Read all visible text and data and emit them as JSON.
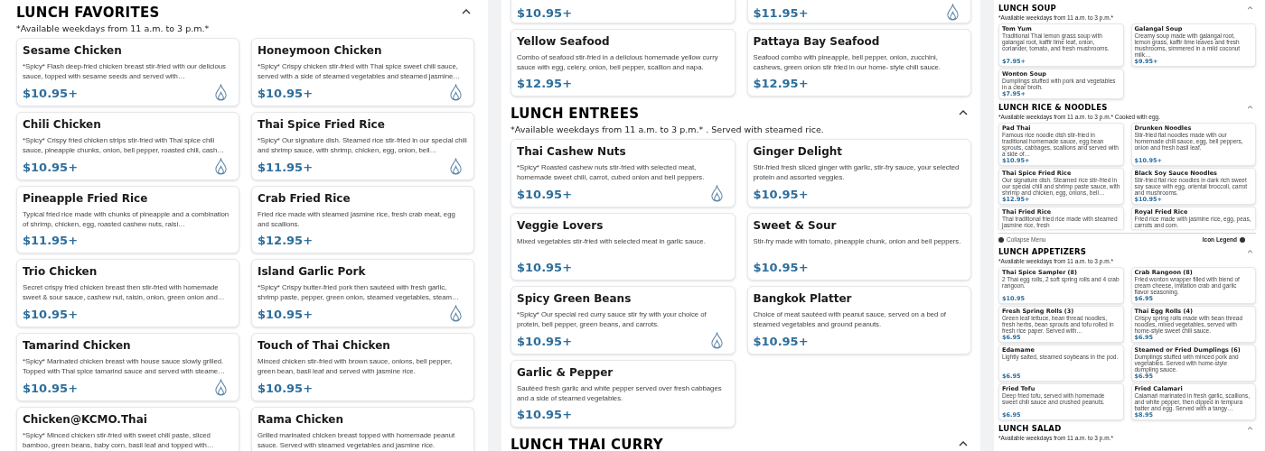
{
  "columns": [
    {
      "panels": [
        {
          "sections": [
            {
              "title": "LUNCH FAVORITES",
              "expanded": true,
              "note": "*Available weekdays from 11 a.m. to 3 p.m.*",
              "items": [
                {
                  "name": "Sesame Chicken",
                  "description": "*Spicy* Flash deep-fried chicken breast stir-fried with our delicious sauce, topped with sesame seeds and served with…",
                  "price": "$10.95+",
                  "spicy": true
                },
                {
                  "name": "Honeymoon Chicken",
                  "description": "*Spicy* Crispy chicken stir-fried with Thai spice sweet chili sauce, served with a side of steamed vegetables and steamed jasmine…",
                  "price": "$10.95+",
                  "spicy": true
                },
                {
                  "name": "Chili Chicken",
                  "description": "*Spicy* Crispy fried chicken strips stir-fried with Thai spice chili sauce, pineapple chunks, onion, bell pepper, roasted chili, cash…",
                  "price": "$10.95+",
                  "spicy": true
                },
                {
                  "name": "Thai Spice Fried Rice",
                  "description": "*Spicy* Our signature dish. Steamed rice stir-fried in our special chili and shrimp sauce, with shrimp, chicken, egg, onion, bell…",
                  "price": "$11.95+",
                  "spicy": true
                },
                {
                  "name": "Pineapple Fried Rice",
                  "description": "Typical fried rice made with chunks of pineapple and a combination of shrimp, chicken, egg, roasted cashew nuts, raisi…",
                  "price": "$11.95+",
                  "spicy": false
                },
                {
                  "name": "Crab Fried Rice",
                  "description": "Fried rice made with steamed jasmine rice, fresh crab meat, egg and scallions.",
                  "price": "$12.95+",
                  "spicy": false
                },
                {
                  "name": "Trio Chicken",
                  "description": "Secret crispy fried chicken breast then stir-fried with homemade sweet & sour sauce, cashew nut, raisin, onion, green onion and…",
                  "price": "$10.95+",
                  "spicy": false
                },
                {
                  "name": "Island Garlic Pork",
                  "description": "*Spicy* Crispy butter-fried pork then sautéed with fresh garlic, shrimp paste, pepper, green onion, steamed vegetables, steam…",
                  "price": "$10.95+",
                  "spicy": true
                },
                {
                  "name": "Tamarind Chicken",
                  "description": "*Spicy* Marinated chicken breast with house sauce slowly grilled. Topped with Thai spice tamarind sauce and served with steame…",
                  "price": "$10.95+",
                  "spicy": true
                },
                {
                  "name": "Touch of Thai Chicken",
                  "description": "Minced chicken stir-fried with brown sauce, onions, bell pepper, green bean, basil leaf and served with jasmine rice.",
                  "price": "$10.95+",
                  "spicy": false
                },
                {
                  "name": "Chicken@KCMO.Thai",
                  "description": "*Spicy* Minced chicken stir-fried with sweet chili paste, sliced bamboo, green beans, baby corn, basil leaf and topped with…"
                },
                {
                  "name": "Rama Chicken",
                  "description": "Grilled marinated chicken breast topped with homemade peanut sauce. Served with steamed vegetables and jasmine rice."
                }
              ]
            }
          ]
        }
      ]
    },
    {
      "panels": [
        {
          "sections": [
            {
              "items": [
                {
                  "price": "$10.95+",
                  "spicy": false
                },
                {
                  "price": "$11.95+",
                  "spicy": true
                },
                {
                  "name": "Yellow Seafood",
                  "description": "Combo of seafood stir-fried in a delicious homemade yellow curry sauce with egg, celery, onion, bell pepper, scallion and napa.",
                  "price": "$12.95+",
                  "spicy": false
                },
                {
                  "name": "Pattaya Bay Seafood",
                  "description": "Seafood combo with pineapple, bell pepper, onion, zucchini, cashews, green onion stir fried in our home- style chili sauce.",
                  "price": "$12.95+",
                  "spicy": false
                }
              ]
            },
            {
              "title": "LUNCH ENTREES",
              "expanded": true,
              "note": "*Available weekdays from 11 a.m. to 3 p.m.* . Served with steamed rice.",
              "items": [
                {
                  "name": "Thai Cashew Nuts",
                  "description": "*Spicy* Roasted cashew nuts stir-fried with selected meat, homemade sweet chili, carrot, cubed onion and bell peppers.",
                  "price": "$10.95+",
                  "spicy": true
                },
                {
                  "name": "Ginger Delight",
                  "description": "Stir-fried fresh sliced ginger with garlic, stir-fry sauce, your selected protein and assorted veggies.",
                  "price": "$10.95+",
                  "spicy": false
                },
                {
                  "name": "Veggie Lovers",
                  "description": "Mixed vegetables stir-fried with selected meat in garlic sauce.",
                  "price": "$10.95+",
                  "spicy": false
                },
                {
                  "name": "Sweet & Sour",
                  "description": "Stir-fry made with tomato, pineapple chunk, onion and bell peppers.",
                  "price": "$10.95+",
                  "spicy": false
                },
                {
                  "name": "Spicy Green Beans",
                  "description": "*Spicy* Our special red curry sauce stir fry with your choice of protein, bell pepper, green beans, and carrots.",
                  "price": "$10.95+",
                  "spicy": true
                },
                {
                  "name": "Bangkok Platter",
                  "description": "Choice of meat sautéed with peanut sauce, served on a bed of steamed vegetables and ground peanuts.",
                  "price": "$10.95+",
                  "spicy": false
                },
                {
                  "name": "Garlic & Pepper",
                  "description": "Sautéed fresh garlic and white pepper served over fresh cabbages and a side of steamed vegetables.",
                  "price": "$10.95+",
                  "spicy": false
                }
              ]
            },
            {
              "title": "LUNCH THAI CURRY",
              "expanded": true
            }
          ]
        }
      ]
    },
    {
      "panels": [
        {
          "sections": [
            {
              "title": "LUNCH SOUP",
              "expanded": true,
              "note": "*Available weekdays from 11 a.m. to 3 p.m.*",
              "items": [
                {
                  "name": "Tom Yum",
                  "description": "Traditional Thai lemon grass soup with galangal root, kaffir lime leaf, onion, coriander, tomato, and fresh mushrooms.",
                  "price": "$7.95+",
                  "spicy": false
                },
                {
                  "name": "Galangal Soup",
                  "description": "Creamy soup made with galangal root, lemon grass, kaffir lime leaves and fresh mushrooms, simmered in a mild coconut milk…",
                  "price": "$9.95+",
                  "spicy": false
                },
                {
                  "name": "Wonton Soup",
                  "description": "Dumplings stuffed with pork and vegetables in a clear broth.",
                  "price": "$7.95+",
                  "spicy": false
                }
              ]
            },
            {
              "title": "LUNCH RICE & NOODLES",
              "expanded": true,
              "note": "*Available weekdays from 11 a.m. to 3 p.m.* Cooked with egg.",
              "items": [
                {
                  "name": "Pad Thai",
                  "description": "Famous rice noodle dish stir-fried in traditional homemade sauce, egg bean sprouts, cabbages, scallions and served with a side of…",
                  "price": "$10.95+",
                  "spicy": false
                },
                {
                  "name": "Drunken Noodles",
                  "description": "Stir-fried flat noodles made with our homemade chili sauce, egg, bell peppers, onion and fresh basil leaf.",
                  "price": "$10.95+",
                  "spicy": false
                },
                {
                  "name": "Thai Spice Fried Rice",
                  "description": "Our signature dish. Steamed rice stir-fried in our special chili and shrimp paste sauce, with shrimp and chicken, egg, onions, bell…",
                  "price": "$12.95+",
                  "spicy": false
                },
                {
                  "name": "Black Soy Sauce Noodles",
                  "description": "Stir-fried flat rice noodles in dark rich sweet soy sauce with egg, oriental broccoli, carrot and mushrooms.",
                  "price": "$10.95+",
                  "spicy": false
                },
                {
                  "name": "Thai Fried Rice",
                  "description": "Thai traditional fried rice made with steamed jasmine rice, fresh"
                },
                {
                  "name": "Royal Fried Rice",
                  "description": "Fried rice made with jasmine rice, egg, peas, carrots and corn."
                }
              ]
            }
          ]
        },
        {
          "toolbar": {
            "collapse_label": "Collapse Menu",
            "legend_label": "Icon Legend"
          },
          "sections": [
            {
              "title": "LUNCH APPETIZERS",
              "expanded": true,
              "note": "*Available weekdays from 11 a.m. to 3 p.m.*",
              "items": [
                {
                  "name": "Thai Spice Sampler (8)",
                  "description": "2 Thai egg rolls, 2 soft spring rolls and 4 crab rangoon.",
                  "price": "$10.95",
                  "spicy": false
                },
                {
                  "name": "Crab Rangoon (8)",
                  "description": "Fried wonton wrapper filled with blend of cream cheese, imitation crab and garlic flavor seasoning.",
                  "price": "$6.95",
                  "spicy": false
                },
                {
                  "name": "Fresh Spring Rolls (3)",
                  "description": "Green leaf lettuce, bean thread noodles, fresh herbs, bean sprouts and tofu rolled in fresh rice paper. Served with…",
                  "price": "$6.95",
                  "spicy": false
                },
                {
                  "name": "Thai Egg Rolls (4)",
                  "description": "Crispy spring rolls made with bean thread noodles, mixed vegetables, served with home-style sweet chili sauce.",
                  "price": "$6.95",
                  "spicy": false
                },
                {
                  "name": "Edamame",
                  "description": "Lightly salted, steamed soybeans in the pod.",
                  "price": "$6.95",
                  "spicy": false
                },
                {
                  "name": "Steamed or Fried Dumplings (6)",
                  "description": "Dumplings stuffed with minced pork and vegetables. Served with home-style dumpling sauce.",
                  "price": "$6.95",
                  "spicy": false
                },
                {
                  "name": "Fried Tofu",
                  "description": "Deep fried tofu, served with homemade sweet chili sauce and crushed peanuts.",
                  "price": "$6.95",
                  "spicy": false
                },
                {
                  "name": "Fried Calamari",
                  "description": "Calamari marinated in fresh garlic, scallions, and white pepper, then dipped in tempura batter and egg. Served with a tangy…",
                  "price": "$8.95",
                  "spicy": false
                }
              ]
            },
            {
              "title": "LUNCH SALAD",
              "expanded": true,
              "note": "*Available weekdays from 11 a.m. to 3 p.m.*"
            }
          ]
        }
      ]
    }
  ]
}
